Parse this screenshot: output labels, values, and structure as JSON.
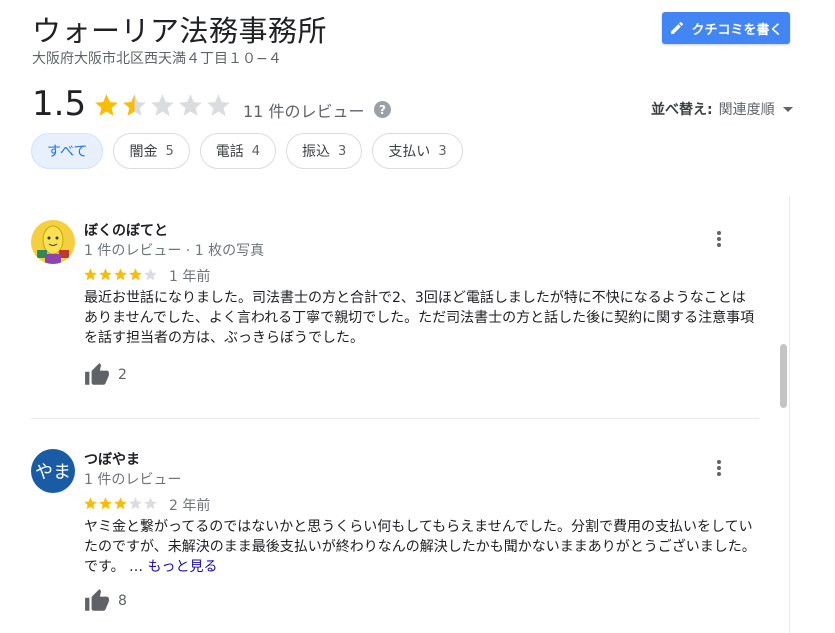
{
  "header": {
    "title": "ウォーリア法務事務所",
    "address": "大阪府大阪市北区西天満４丁目１０−４",
    "write_review_label": "クチコミを書く"
  },
  "summary": {
    "rating": "1.5",
    "rating_value": 1.5,
    "review_count_label": "11 件のレビュー",
    "help_label": "?"
  },
  "sort": {
    "label": "並べ替え:",
    "value": "関連度順"
  },
  "filters": [
    {
      "label": "すべて",
      "count": ""
    },
    {
      "label": "闇金",
      "count": "5"
    },
    {
      "label": "電話",
      "count": "4"
    },
    {
      "label": "振込",
      "count": "3"
    },
    {
      "label": "支払い",
      "count": "3"
    }
  ],
  "reviews": [
    {
      "name": "ぼくのぼてと",
      "meta": "1 件のレビュー · 1 枚の写真",
      "rating": 4,
      "date": "1 年前",
      "text": "最近お世話になりました。司法書士の方と合計で2、3回ほど電話しましたが特に不快になるようなことはありませんでした、よく言われる丁寧で親切でした。ただ司法書士の方と話した後に契約に関する注意事項を話す担当者の方は、ぶっきらぼうでした。",
      "more": "",
      "likes": "2"
    },
    {
      "name": "つぼやま",
      "avatar_text": "やま",
      "meta": "1 件のレビュー",
      "rating": 3,
      "date": "2 年前",
      "text": "ヤミ金と繋がってるのではないかと思うくらい何もしてもらえませんでした。分割で費用の支払いをしていたのですが、未解決のまま最後支払いが終わりなんの解決したかも聞かないままありがとうございました。です。 … ",
      "more": "もっと見る",
      "likes": "8"
    }
  ],
  "colors": {
    "star_filled": "#fbbc04",
    "star_empty": "#dadce0",
    "accent": "#4285f4",
    "chip_active_bg": "#e8f0fe",
    "avatar2_bg": "#1a5ba6"
  },
  "icons": {
    "write": "pencil-icon",
    "help": "help-icon",
    "sort": "caret-down-icon",
    "menu": "more-vert-icon",
    "like": "thumb-up-icon"
  }
}
